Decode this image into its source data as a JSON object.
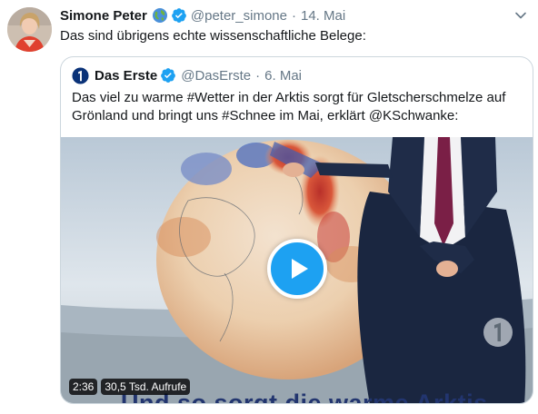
{
  "tweet": {
    "author_name": "Simone Peter",
    "author_emoji": "globe-emoji",
    "author_handle": "@peter_simone",
    "separator": "·",
    "date": "14. Mai",
    "text": "Das sind übrigens echte wissenschaftliche Belege:"
  },
  "quoted_tweet": {
    "author_name": "Das Erste",
    "author_handle": "@DasErste",
    "separator": "·",
    "date": "6. Mai",
    "text": "Das viel zu warme #Wetter in der Arktis sorgt für Gletscherschmelze auf Grönland und bringt uns #Schnee im Mai, erklärt @KSchwanke:",
    "video": {
      "duration": "2:36",
      "views": "30,5 Tsd. Aufrufe",
      "caption": "Und so sorgt die warme Arktis"
    }
  },
  "icons": [
    "verified-badge-icon",
    "chevron-down-icon",
    "das-erste-logo-icon",
    "play-icon",
    "ard-watermark-icon"
  ],
  "colors": {
    "accent": "#1da1f2",
    "muted_text": "#657786",
    "border": "#ccd6dd",
    "caption": "#22356f"
  }
}
